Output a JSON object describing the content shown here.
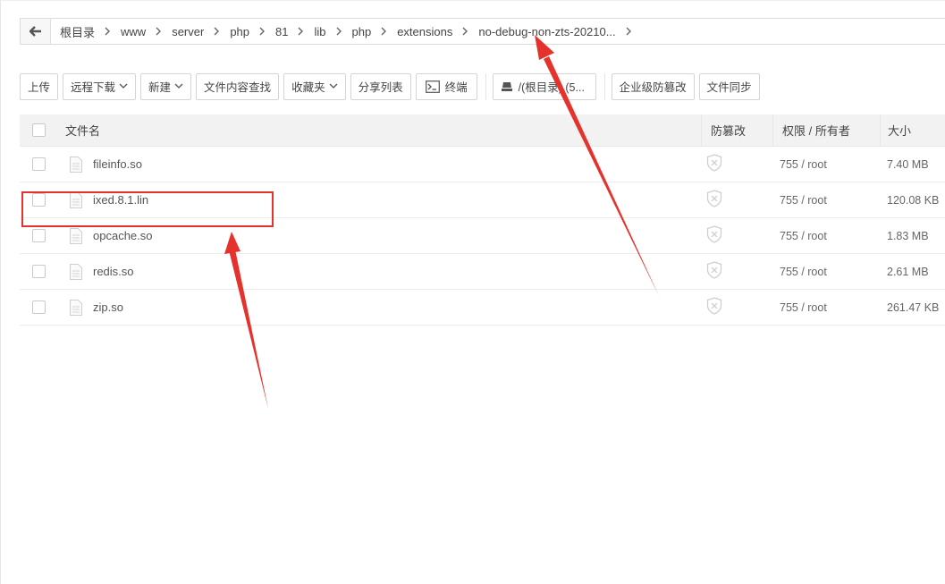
{
  "breadcrumb": {
    "items": [
      "根目录",
      "www",
      "server",
      "php",
      "81",
      "lib",
      "php",
      "extensions",
      "no-debug-non-zts-20210..."
    ]
  },
  "toolbar": {
    "upload": "上传",
    "remote_download": "远程下载",
    "new": "新建",
    "content_search": "文件内容查找",
    "favorites": "收藏夹",
    "share_list": "分享列表",
    "terminal": "终端",
    "disk": "/(根目录) (5...",
    "enterprise_tamper": "企业级防篡改",
    "file_sync": "文件同步"
  },
  "table": {
    "headers": {
      "name": "文件名",
      "anti_tamper": "防篡改",
      "permission": "权限 / 所有者",
      "size": "大小"
    },
    "rows": [
      {
        "name": "fileinfo.so",
        "perm": "755 / root",
        "size": "7.40 MB"
      },
      {
        "name": "ixed.8.1.lin",
        "perm": "755 / root",
        "size": "120.08 KB"
      },
      {
        "name": "opcache.so",
        "perm": "755 / root",
        "size": "1.83 MB"
      },
      {
        "name": "redis.so",
        "perm": "755 / root",
        "size": "2.61 MB"
      },
      {
        "name": "zip.so",
        "perm": "755 / root",
        "size": "261.47 KB"
      }
    ]
  },
  "colors": {
    "annotation": "#e5322d",
    "header_bg": "#f2f2f2"
  },
  "icons": {
    "back": "arrow-left-icon",
    "caret": "chevron-down-icon",
    "terminal": "terminal-icon",
    "disk": "disk-icon",
    "file": "file-icon",
    "shield": "shield-x-icon"
  }
}
